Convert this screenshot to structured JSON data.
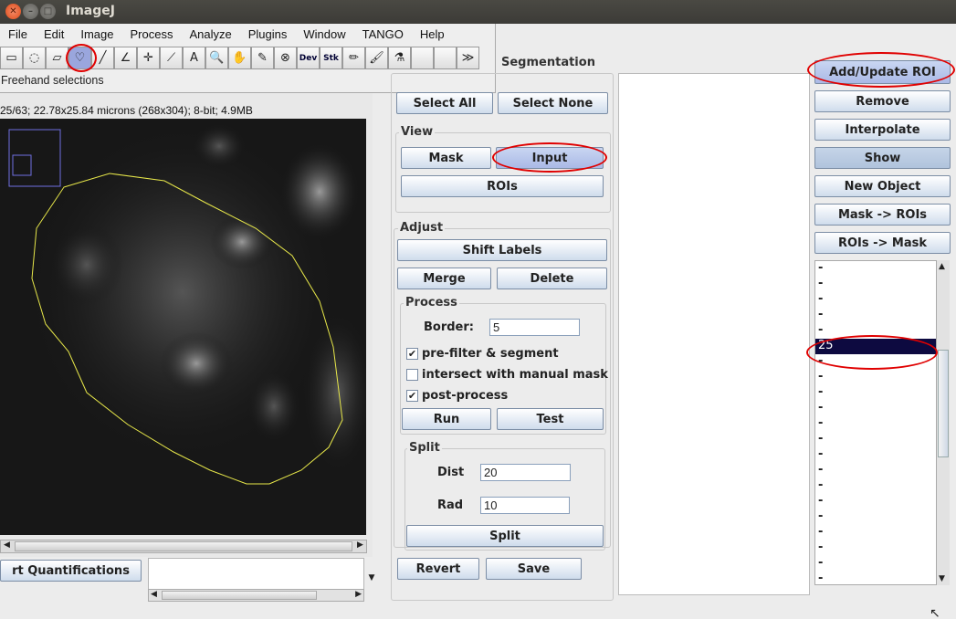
{
  "window": {
    "title": "ImageJ"
  },
  "menus": [
    "File",
    "Edit",
    "Image",
    "Process",
    "Analyze",
    "Plugins",
    "Window",
    "TANGO",
    "Help"
  ],
  "tools": [
    {
      "name": "rectangle-tool-icon",
      "glyph": "▭"
    },
    {
      "name": "oval-tool-icon",
      "glyph": "◌"
    },
    {
      "name": "polygon-tool-icon",
      "glyph": "▱"
    },
    {
      "name": "freehand-tool-icon",
      "glyph": "♡"
    },
    {
      "name": "line-tool-icon",
      "glyph": "╱"
    },
    {
      "name": "angle-tool-icon",
      "glyph": "∠"
    },
    {
      "name": "point-tool-icon",
      "glyph": "✛"
    },
    {
      "name": "wand-tool-icon",
      "glyph": "⟋"
    },
    {
      "name": "text-tool-icon",
      "glyph": "A"
    },
    {
      "name": "magnifier-tool-icon",
      "glyph": "🔍"
    },
    {
      "name": "hand-tool-icon",
      "glyph": "✋"
    },
    {
      "name": "dropper-tool-icon",
      "glyph": "✎"
    },
    {
      "name": "close-roi-icon",
      "glyph": "⊗"
    },
    {
      "name": "dev-tool-icon",
      "glyph": "Dev"
    },
    {
      "name": "stk-tool-icon",
      "glyph": "Stk"
    },
    {
      "name": "pencil-tool-icon",
      "glyph": "✏"
    },
    {
      "name": "brush-tool-icon",
      "glyph": "🖌"
    },
    {
      "name": "flood-fill-tool-icon",
      "glyph": "⚗"
    },
    {
      "name": "blank-tool-1",
      "glyph": ""
    },
    {
      "name": "blank-tool-2",
      "glyph": ""
    },
    {
      "name": "more-tools-icon",
      "glyph": "≫"
    }
  ],
  "status": "Freehand selections",
  "image": {
    "info": "25/63; 22.78x25.84 microns (268x304); 8-bit; 4.9MB"
  },
  "quant_button": "rt Quantifications",
  "segmentation": {
    "title": "Segmentation",
    "select_all": "Select All",
    "select_none": "Select None",
    "view": {
      "title": "View",
      "mask": "Mask",
      "input": "Input",
      "rois": "ROIs"
    },
    "adjust": {
      "title": "Adjust",
      "shift_labels": "Shift Labels",
      "merge": "Merge",
      "delete": "Delete"
    },
    "process": {
      "title": "Process",
      "border_label": "Border:",
      "border_value": "5",
      "pre_filter": "pre-filter & segment",
      "pre_filter_checked": true,
      "intersect": "intersect with manual mask",
      "intersect_checked": false,
      "post_process": "post-process",
      "post_process_checked": true,
      "run": "Run",
      "test": "Test"
    },
    "split": {
      "title": "Split",
      "dist_label": "Dist",
      "dist_value": "20",
      "rad_label": "Rad",
      "rad_value": "10",
      "split": "Split"
    },
    "revert": "Revert",
    "save": "Save"
  },
  "roi_panel": {
    "add_update": "Add/Update ROI",
    "remove": "Remove",
    "interpolate": "Interpolate",
    "show": "Show",
    "new_object": "New Object",
    "mask_to_rois": "Mask -> ROIs",
    "rois_to_mask": "ROIs -> Mask",
    "list": [
      "-",
      "-",
      "-",
      "-",
      "-",
      "25",
      "-",
      "-",
      "-",
      "-",
      "-",
      "-",
      "-",
      "-",
      "-",
      "-",
      "-",
      "-",
      "-",
      "-",
      "-"
    ],
    "selected": "25"
  }
}
